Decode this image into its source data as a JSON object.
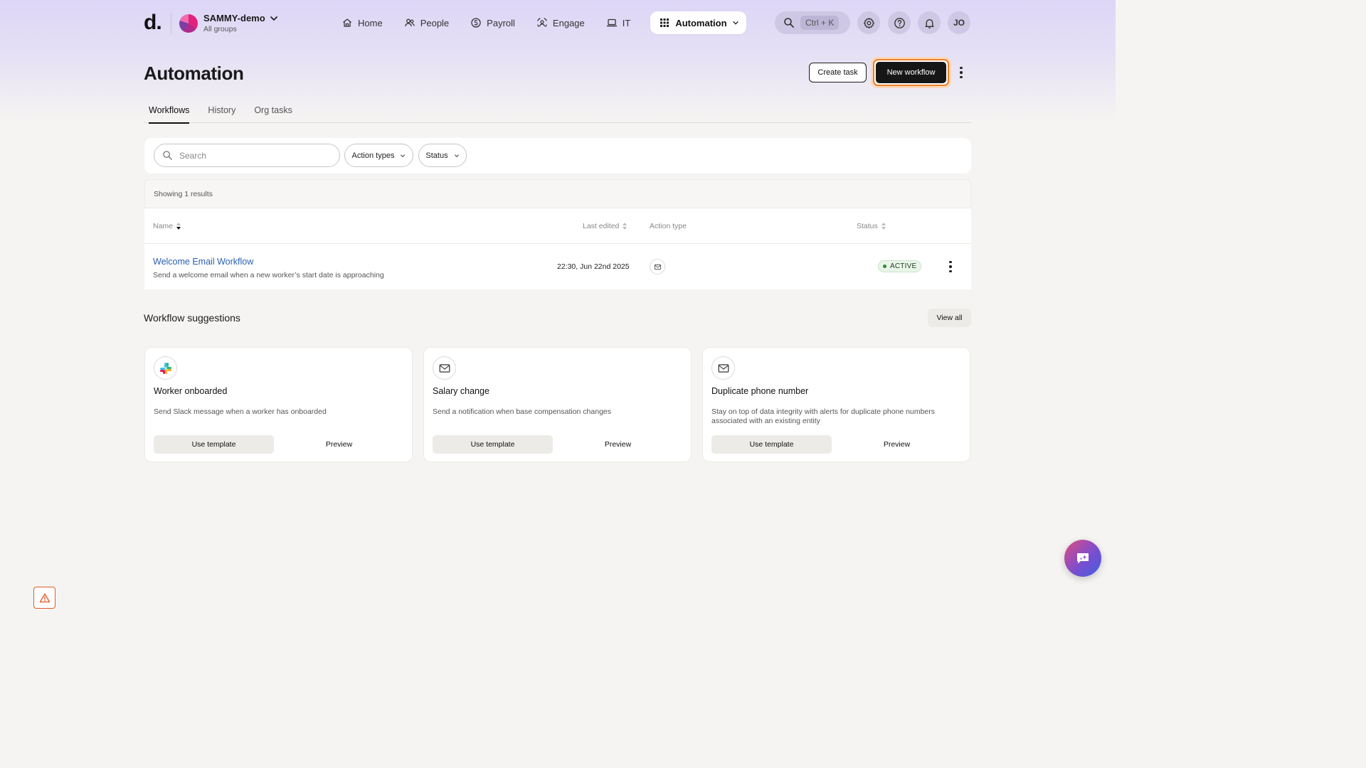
{
  "brand": {
    "logo_text": "d."
  },
  "org": {
    "name": "SAMMY-demo",
    "subtitle": "All groups"
  },
  "nav": {
    "items": [
      {
        "label": "Home",
        "icon": "home-icon"
      },
      {
        "label": "People",
        "icon": "people-icon"
      },
      {
        "label": "Payroll",
        "icon": "payroll-icon"
      },
      {
        "label": "Engage",
        "icon": "engage-icon"
      },
      {
        "label": "IT",
        "icon": "laptop-icon"
      },
      {
        "label": "Automation",
        "icon": "grid-icon",
        "active": true
      }
    ]
  },
  "utility": {
    "search_shortcut": "Ctrl + K",
    "user_initials": "JO"
  },
  "header": {
    "title": "Automation",
    "create_task_label": "Create task",
    "new_workflow_label": "New workflow"
  },
  "tabs": [
    {
      "label": "Workflows",
      "active": true
    },
    {
      "label": "History"
    },
    {
      "label": "Org tasks"
    }
  ],
  "filters": {
    "search_placeholder": "Search",
    "action_types_label": "Action types",
    "status_label": "Status"
  },
  "results": {
    "summary": "Showing 1 results",
    "columns": {
      "name": "Name",
      "last_edited": "Last edited",
      "action_type": "Action type",
      "status": "Status"
    },
    "rows": [
      {
        "name": "Welcome Email Workflow",
        "description": "Send a welcome email when a new worker’s start date is approaching",
        "last_edited": "22:30, Jun 22nd 2025",
        "action_icon": "mail-icon",
        "status": "ACTIVE"
      }
    ]
  },
  "suggestions": {
    "title": "Workflow suggestions",
    "view_all_label": "View all",
    "cards": [
      {
        "icon": "slack-icon",
        "title": "Worker onboarded",
        "description": "Send Slack message when a worker has onboarded",
        "use_label": "Use template",
        "preview_label": "Preview"
      },
      {
        "icon": "mail-icon",
        "title": "Salary change",
        "description": "Send a notification when base compensation changes",
        "use_label": "Use template",
        "preview_label": "Preview"
      },
      {
        "icon": "mail-icon",
        "title": "Duplicate phone number",
        "description": "Stay on top of data integrity with alerts for duplicate phone numbers associated with an existing entity",
        "use_label": "Use template",
        "preview_label": "Preview"
      }
    ]
  },
  "colors": {
    "header_gradient": "#ddd6f6",
    "primary_button": "#161616",
    "focus_ring": "#f07d25",
    "link": "#2a5fb0",
    "status_active": "#2e8b3a"
  }
}
